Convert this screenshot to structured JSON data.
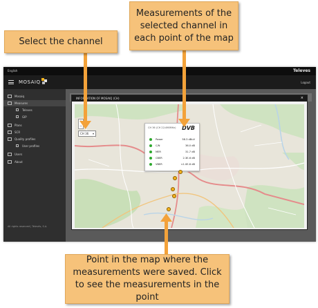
{
  "app": {
    "language": "English",
    "brand_right": "Televes",
    "logo_text": "MOSAIQ",
    "logout": "Logout",
    "footer": "All rights reserved | Televés, S.A."
  },
  "sidebar": {
    "items": [
      {
        "label": "Mosaiq",
        "icon": "monitor-icon"
      },
      {
        "label": "Measures",
        "icon": "chart-icon",
        "active": true
      },
      {
        "label": "Televes",
        "icon": "folder-icon",
        "sub": true
      },
      {
        "label": "GIP",
        "icon": "folder-icon",
        "sub": true
      },
      {
        "label": "Plans",
        "icon": "list-icon"
      },
      {
        "label": "SCR",
        "icon": "circle-icon"
      },
      {
        "label": "Quality profiles",
        "icon": "people-icon"
      },
      {
        "label": "User profiles",
        "icon": "user-icon",
        "sub": true
      },
      {
        "label": "Users",
        "icon": "users-icon"
      },
      {
        "label": "About",
        "icon": "info-icon"
      }
    ]
  },
  "content": {
    "background_label": "INFORMATION OF MOSAIQ"
  },
  "modal": {
    "title": "INFORMATION OF MOSAIQ (CH)",
    "close": "×",
    "channel_value": "CH 36",
    "zoom_in": "+",
    "zoom_out": "−"
  },
  "popup": {
    "heading": "CH 36 (CH 22/498MHz)",
    "logo": "DVB",
    "measures": [
      {
        "name": "Power",
        "value": "58.3 dBuV"
      },
      {
        "name": "C/N",
        "value": "36.0 dB"
      },
      {
        "name": "MER",
        "value": "31.7 dB"
      },
      {
        "name": "CBER",
        "value": "2.3E-6 dB"
      },
      {
        "name": "VBER",
        "value": "<1.0E-8 dB"
      }
    ]
  },
  "callouts": {
    "channel": "Select the channel",
    "measurements": "Measurements of the selected channel in each point of the map",
    "point": "Point in the map where the measurements were saved. Click to see the measurements in the point"
  },
  "colors": {
    "callout_fill": "#f6c27a",
    "arrow": "#f3a23a",
    "status_ok": "#2ea82e",
    "pin": "#f2b21c"
  }
}
